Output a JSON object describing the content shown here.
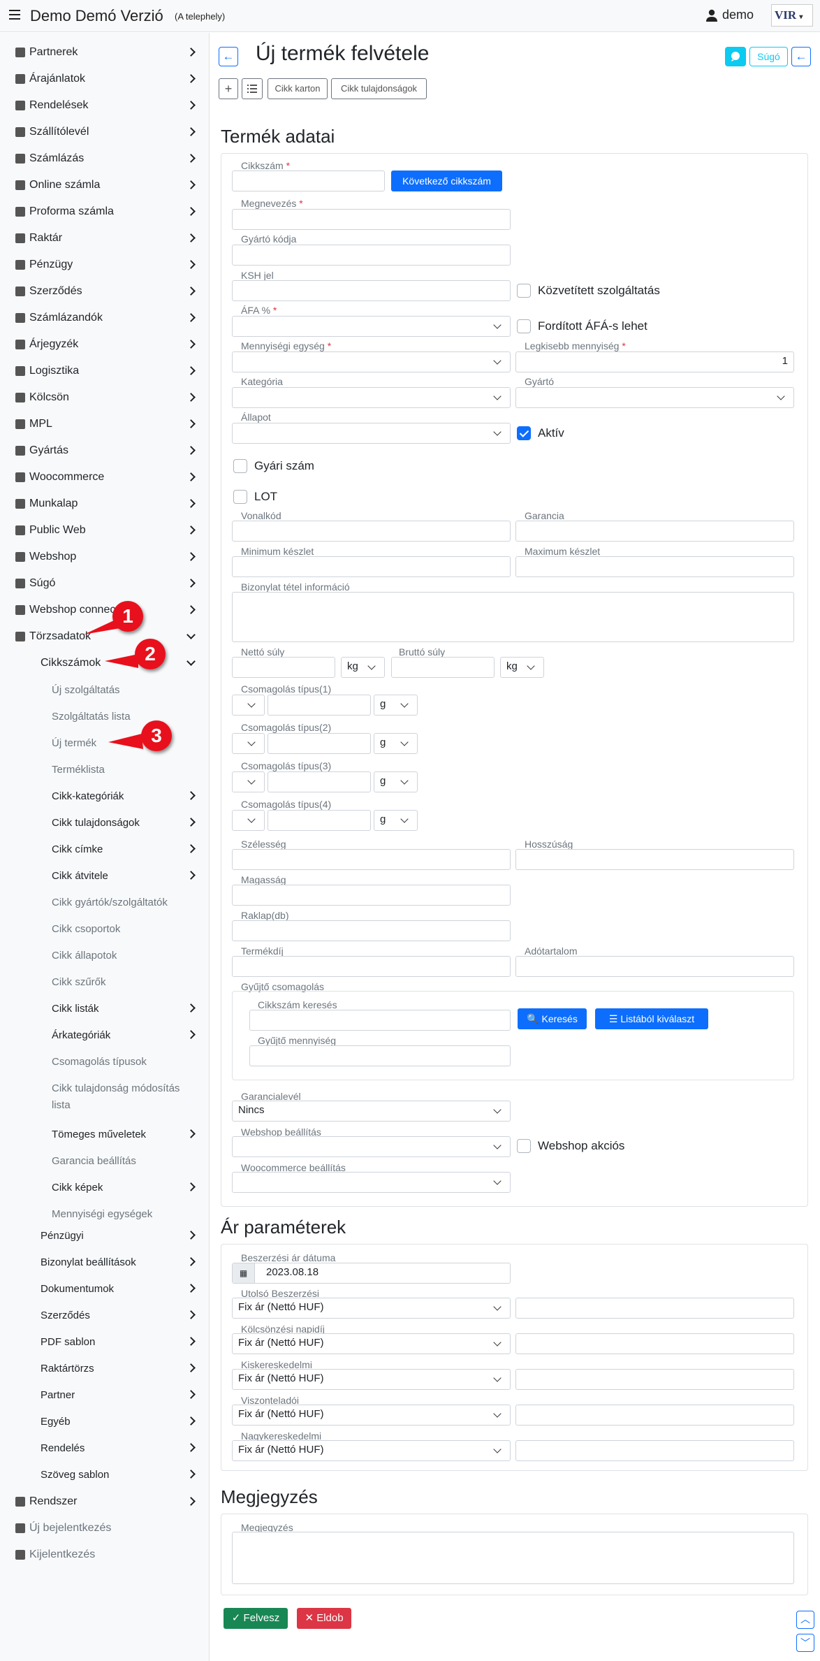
{
  "header": {
    "app_title": "Demo Demó Verzió",
    "site": "(A telephely)",
    "user": "demo",
    "logo_text": "VIR"
  },
  "sidebar": {
    "items": [
      {
        "label": "Partnerek"
      },
      {
        "label": "Árajánlatok"
      },
      {
        "label": "Rendelések"
      },
      {
        "label": "Szállítólevél"
      },
      {
        "label": "Számlázás"
      },
      {
        "label": "Online számla"
      },
      {
        "label": "Proforma számla"
      },
      {
        "label": "Raktár"
      },
      {
        "label": "Pénzügy"
      },
      {
        "label": "Szerződés"
      },
      {
        "label": "Számlázandók"
      },
      {
        "label": "Árjegyzék"
      },
      {
        "label": "Logisztika"
      },
      {
        "label": "Kölcsön"
      },
      {
        "label": "MPL"
      },
      {
        "label": "Gyártás"
      },
      {
        "label": "Woocommerce"
      },
      {
        "label": "Munkalap"
      },
      {
        "label": "Public Web"
      },
      {
        "label": "Webshop"
      },
      {
        "label": "Súgó"
      },
      {
        "label": "Webshop connector"
      },
      {
        "label": "Törzsadatok"
      }
    ],
    "sub": [
      {
        "label": "Cikkszámok"
      }
    ],
    "cikk": [
      {
        "label": "Új szolgáltatás"
      },
      {
        "label": "Szolgáltatás lista"
      },
      {
        "label": "Új termék"
      },
      {
        "label": "Terméklista"
      },
      {
        "label": "Cikk-kategóriák"
      },
      {
        "label": "Cikk tulajdonságok"
      },
      {
        "label": "Cikk címke"
      },
      {
        "label": "Cikk átvitele"
      },
      {
        "label": "Cikk gyártók/szolgáltatók"
      },
      {
        "label": "Cikk csoportok"
      },
      {
        "label": "Cikk állapotok"
      },
      {
        "label": "Cikk szűrők"
      },
      {
        "label": "Cikk listák"
      },
      {
        "label": "Árkategóriák"
      },
      {
        "label": "Csomagolás típusok"
      },
      {
        "label": "Cikk tulajdonság módosítás"
      },
      {
        "label": "lista"
      },
      {
        "label": "Tömeges műveletek"
      },
      {
        "label": "Garancia beállítás"
      },
      {
        "label": "Cikk képek"
      },
      {
        "label": "Mennyiségi egységek"
      }
    ],
    "torzs": [
      {
        "label": "Pénzügyi"
      },
      {
        "label": "Bizonylat beállítások"
      },
      {
        "label": "Dokumentumok"
      },
      {
        "label": "Szerződés"
      },
      {
        "label": "PDF sablon"
      },
      {
        "label": "Raktártörzs"
      },
      {
        "label": "Partner"
      },
      {
        "label": "Egyéb"
      },
      {
        "label": "Rendelés"
      },
      {
        "label": "Szöveg sablon"
      }
    ],
    "bottom": [
      {
        "label": "Rendszer"
      },
      {
        "label": "Új bejelentkezés"
      },
      {
        "label": "Kijelentkezés"
      }
    ],
    "badges": [
      "1",
      "2",
      "3"
    ]
  },
  "page": {
    "title": "Új termék felvétele",
    "help": "Súgó",
    "toolbar": {
      "cikk_karton": "Cikk karton",
      "cikk_tulajdonsagok": "Cikk tulajdonságok"
    },
    "sections": {
      "termek": "Termék adatai",
      "ar": "Ár paraméterek",
      "megjegyzes": "Megjegyzés"
    }
  },
  "form": {
    "cikkszam": "Cikkszám",
    "kovetkezo": "Következő cikkszám",
    "megnevezes": "Megnevezés",
    "gyarto_kodja": "Gyártó kódja",
    "ksh": "KSH jel",
    "kozvetitett": "Közvetített szolgáltatás",
    "afa": "ÁFA %",
    "forditott": "Fordított ÁFÁ-s lehet",
    "mennyisegi": "Mennyiségi egység",
    "legkisebb": "Legkisebb mennyiség",
    "legkisebb_value": "1",
    "kategoria": "Kategória",
    "gyarto": "Gyártó",
    "allapot": "Állapot",
    "aktiv": "Aktív",
    "gyari": "Gyári szám",
    "lot": "LOT",
    "vonalkod": "Vonalkód",
    "garancia": "Garancia",
    "min": "Minimum készlet",
    "max": "Maximum készlet",
    "bizonylat": "Bizonylat tétel információ",
    "netto_suly": "Nettó súly",
    "brutto_suly": "Bruttó súly",
    "kg": "kg",
    "csomag1": "Csomagolás típus(1)",
    "csomag2": "Csomagolás típus(2)",
    "csomag3": "Csomagolás típus(3)",
    "csomag4": "Csomagolás típus(4)",
    "g": "g",
    "szelesseg": "Szélesség",
    "hosszusag": "Hosszúság",
    "magassag": "Magasság",
    "raklap": "Raklap(db)",
    "termekdij": "Termékdíj",
    "adotartalom": "Adótartalom",
    "gyujto": "Gyűjtő csomagolás",
    "cikkszam_kereses": "Cikkszám keresés",
    "kereses": "Keresés",
    "listabol": "Listából kiválaszt",
    "gyujto_mennyiseg": "Gyűjtő mennyiség",
    "garancialevel": "Garancialevél",
    "garancialevel_value": "Nincs",
    "webshop_beall": "Webshop beállítás",
    "webshop_akcios": "Webshop akciós",
    "woo_beall": "Woocommerce beállítás"
  },
  "prices": {
    "date_label": "Beszerzési ár dátuma",
    "date_value": "2023.08.18",
    "rows": [
      {
        "label": "Utolsó Beszerzési",
        "value": "Fix ár (Nettó HUF)"
      },
      {
        "label": "Kölcsönzési napidíj",
        "value": "Fix ár (Nettó HUF)"
      },
      {
        "label": "Kiskereskedelmi",
        "value": "Fix ár (Nettó HUF)"
      },
      {
        "label": "Viszonteladói",
        "value": "Fix ár (Nettó HUF)"
      },
      {
        "label": "Nagykereskedelmi",
        "value": "Fix ár (Nettó HUF)"
      }
    ]
  },
  "note": {
    "label": "Megjegyzés"
  },
  "actions": {
    "save": "Felvesz",
    "discard": "Eldob"
  }
}
